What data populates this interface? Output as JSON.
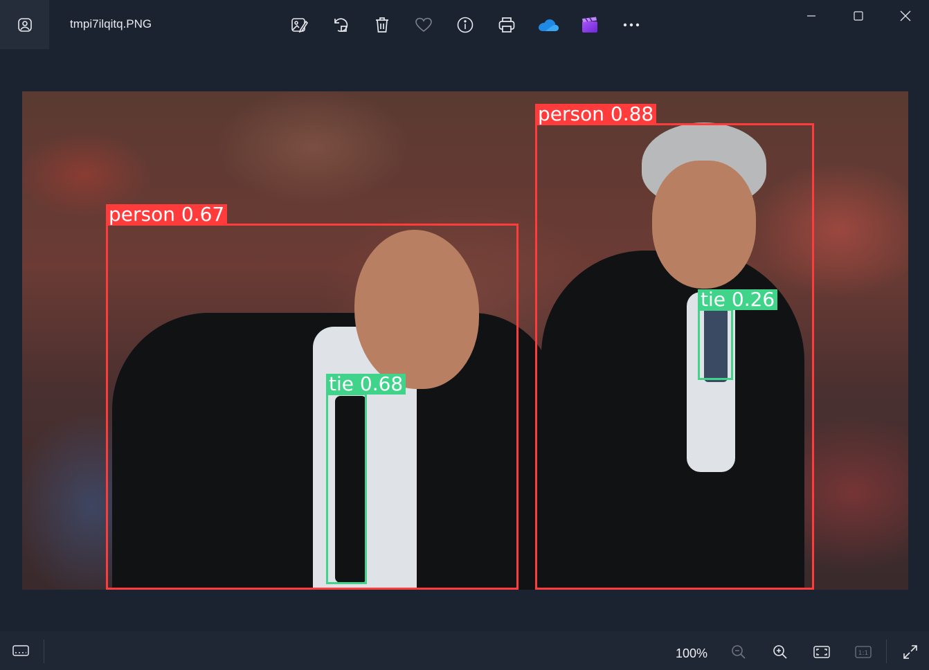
{
  "window": {
    "file_name": "tmpi7ilqitq.PNG"
  },
  "toolbar": {
    "buttons": [
      {
        "name": "edit-image-button",
        "icon": "edit-image-icon"
      },
      {
        "name": "rotate-button",
        "icon": "rotate-icon"
      },
      {
        "name": "delete-button",
        "icon": "trash-icon"
      },
      {
        "name": "favorite-button",
        "icon": "heart-icon"
      },
      {
        "name": "file-info-button",
        "icon": "info-icon"
      },
      {
        "name": "print-button",
        "icon": "printer-icon"
      },
      {
        "name": "onedrive-button",
        "icon": "cloud-icon"
      },
      {
        "name": "clipchamp-button",
        "icon": "clapperboard-icon"
      },
      {
        "name": "more-options-button",
        "icon": "more-icon"
      }
    ]
  },
  "detections": [
    {
      "label": "person 0.67",
      "class": "person",
      "confidence": 0.67
    },
    {
      "label": "person 0.88",
      "class": "person",
      "confidence": 0.88
    },
    {
      "label": "tie 0.68",
      "class": "tie",
      "confidence": 0.68
    },
    {
      "label": "tie 0.26",
      "class": "tie",
      "confidence": 0.26
    }
  ],
  "colors": {
    "person_box": "#ff3b3b",
    "tie_box": "#3fd48a",
    "background": "#1b2230"
  },
  "bottombar": {
    "zoom_level": "100%",
    "actual_size_label": "1:1"
  }
}
